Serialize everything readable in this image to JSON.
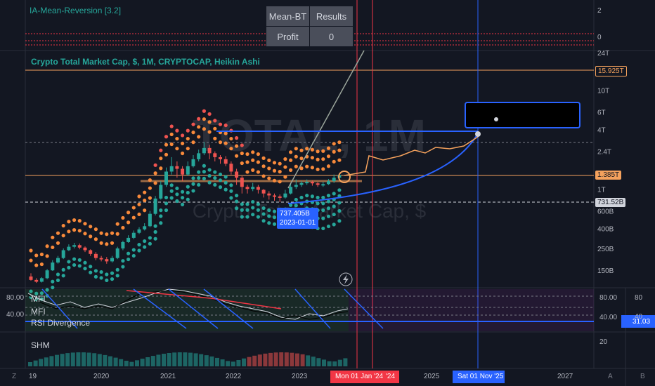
{
  "window": {
    "indicator_title": "IA-Mean-Reversion [3.2]",
    "main_title": "Crypto Total Market Cap, $, 1M, CRYPTOCAP, Heikin Ashi",
    "watermark_big": "TOTAL, 1M",
    "watermark_small": "Crypto Total Market Cap, $"
  },
  "backtest_table": {
    "header_left": "Mean-BT",
    "header_right": "Results",
    "row_label": "Profit",
    "row_value": "0"
  },
  "top_pane": {
    "ticks": [
      "2",
      "0"
    ]
  },
  "price_tags": {
    "upper_target": "15.925T",
    "current": "1.385T",
    "lower": "731.52B"
  },
  "annotation": {
    "low_value": "737.405B",
    "low_date": "2023-01-01"
  },
  "osc_pane": {
    "labels": [
      "MFI",
      "MFI",
      "RSI Divergence"
    ],
    "ticks_left": [
      "80.00",
      "40.00"
    ],
    "ticks_right": [
      "80.00",
      "40.00"
    ],
    "ticks_far": [
      "80",
      "40"
    ],
    "value_tag": "31.03"
  },
  "shm_pane": {
    "label": "SHM",
    "tick": "20"
  },
  "x_axis": {
    "labels": [
      "19",
      "2020",
      "2021",
      "2022",
      "2023",
      "2025",
      "2027"
    ],
    "cursor_left": "Mon 01 Jan '24",
    "cursor_left_suffix": "'24",
    "cursor_right": "Sat 01 Nov '25",
    "corner_left": "Z",
    "corner_a": "A",
    "corner_b": "B"
  },
  "colors": {
    "background": "#131722",
    "bull": "#26a69a",
    "bear": "#ef5350",
    "dots_orange": "#f7893b",
    "dots_green": "#26a69a",
    "projection_orange": "#f5a25d",
    "curve_blue": "#2962ff",
    "accent_blue": "#2962ff",
    "cursor_red": "#f23645"
  },
  "chart_data": {
    "type": "candlestick",
    "scale": "log",
    "y_ticks": [
      "24T",
      "10T",
      "6T",
      "4T",
      "2.4T",
      "1T",
      "600B",
      "400B",
      "250B",
      "150B"
    ],
    "y_tick_values": [
      24000,
      10000,
      6000,
      4000,
      2400,
      1000,
      600,
      400,
      250,
      150
    ],
    "unit": "billions USD",
    "x_labels": [
      "2020",
      "2021",
      "2022",
      "2023",
      "2025",
      "2027"
    ],
    "horizontal_levels": [
      15925,
      1385,
      731.52
    ],
    "annotated_low": {
      "date": "2023-01-01",
      "value": 737.405
    },
    "candles": [
      [
        130,
        120,
        140,
        118
      ],
      [
        120,
        115,
        125,
        112
      ],
      [
        115,
        125,
        128,
        113
      ],
      [
        125,
        150,
        155,
        122
      ],
      [
        150,
        180,
        190,
        148
      ],
      [
        180,
        200,
        210,
        175
      ],
      [
        200,
        240,
        250,
        195
      ],
      [
        240,
        260,
        275,
        235
      ],
      [
        260,
        270,
        285,
        250
      ],
      [
        270,
        255,
        280,
        245
      ],
      [
        255,
        240,
        262,
        230
      ],
      [
        240,
        220,
        245,
        210
      ],
      [
        220,
        200,
        230,
        190
      ],
      [
        200,
        195,
        210,
        185
      ],
      [
        195,
        185,
        205,
        175
      ],
      [
        185,
        200,
        210,
        180
      ],
      [
        200,
        250,
        260,
        195
      ],
      [
        250,
        290,
        300,
        240
      ],
      [
        290,
        320,
        340,
        285
      ],
      [
        320,
        360,
        380,
        310
      ],
      [
        360,
        390,
        410,
        350
      ],
      [
        390,
        420,
        450,
        380
      ],
      [
        420,
        560,
        600,
        410
      ],
      [
        560,
        800,
        850,
        540
      ],
      [
        800,
        1100,
        1200,
        780
      ],
      [
        1100,
        1500,
        1650,
        1050
      ],
      [
        1500,
        1700,
        2100,
        1400
      ],
      [
        1700,
        1600,
        1900,
        1300
      ],
      [
        1600,
        1400,
        1700,
        1200
      ],
      [
        1400,
        1700,
        1900,
        1350
      ],
      [
        1700,
        2000,
        2200,
        1650
      ],
      [
        2000,
        2300,
        2500,
        1900
      ],
      [
        2300,
        2600,
        3000,
        2200
      ],
      [
        2600,
        2300,
        2800,
        2000
      ],
      [
        2300,
        2100,
        2400,
        1900
      ],
      [
        2100,
        2000,
        2200,
        1800
      ],
      [
        2000,
        1800,
        2150,
        1700
      ],
      [
        1800,
        1500,
        1900,
        1400
      ],
      [
        1500,
        1300,
        1600,
        1100
      ],
      [
        1300,
        1050,
        1350,
        900
      ],
      [
        1050,
        1000,
        1100,
        900
      ],
      [
        1000,
        1050,
        1150,
        950
      ],
      [
        1050,
        980,
        1100,
        900
      ],
      [
        980,
        900,
        1000,
        820
      ],
      [
        900,
        860,
        950,
        780
      ],
      [
        860,
        840,
        900,
        760
      ],
      [
        840,
        820,
        880,
        737
      ],
      [
        820,
        900,
        980,
        800
      ],
      [
        900,
        1050,
        1150,
        880
      ],
      [
        1050,
        1100,
        1250,
        1000
      ],
      [
        1100,
        1150,
        1200,
        1050
      ],
      [
        1150,
        1180,
        1250,
        1100
      ],
      [
        1180,
        1140,
        1220,
        1080
      ],
      [
        1140,
        1100,
        1170,
        1050
      ],
      [
        1100,
        1120,
        1180,
        1050
      ],
      [
        1120,
        1200,
        1260,
        1100
      ],
      [
        1200,
        1300,
        1400,
        1150
      ],
      [
        1300,
        1385,
        1450,
        1250
      ]
    ],
    "projection": {
      "orange_path": [
        [
          1385,
          1
        ],
        [
          1500,
          2
        ],
        [
          1800,
          4
        ],
        [
          2000,
          6
        ],
        [
          2300,
          9
        ],
        [
          2700,
          13
        ],
        [
          3200,
          17
        ],
        [
          3800,
          22
        ]
      ],
      "blue_curve_end": 3800
    }
  }
}
